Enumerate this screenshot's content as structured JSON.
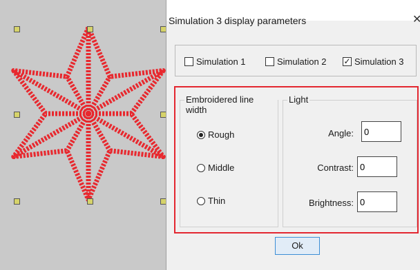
{
  "dialog": {
    "title": "Simulation 3 display parameters",
    "close_icon": "close-icon"
  },
  "simulations": [
    {
      "label": "Simulation 1",
      "checked": false
    },
    {
      "label": "Simulation 2",
      "checked": false
    },
    {
      "label": "Simulation 3",
      "checked": true
    }
  ],
  "line_width": {
    "label": "Embroidered line width",
    "options": [
      {
        "label": "Rough",
        "selected": true
      },
      {
        "label": "Middle",
        "selected": false
      },
      {
        "label": "Thin",
        "selected": false
      }
    ]
  },
  "light": {
    "label": "Light",
    "angle": {
      "label": "Angle:",
      "value": "0"
    },
    "contrast": {
      "label": "Contrast:",
      "value": "0"
    },
    "brightness": {
      "label": "Brightness:",
      "value": "0"
    }
  },
  "ok_label": "Ok",
  "colors": {
    "embroidery": "#e8282e",
    "highlight_frame": "#e3262f",
    "handle": "#d6d36a",
    "canvas_bg": "#c9c9c9"
  }
}
